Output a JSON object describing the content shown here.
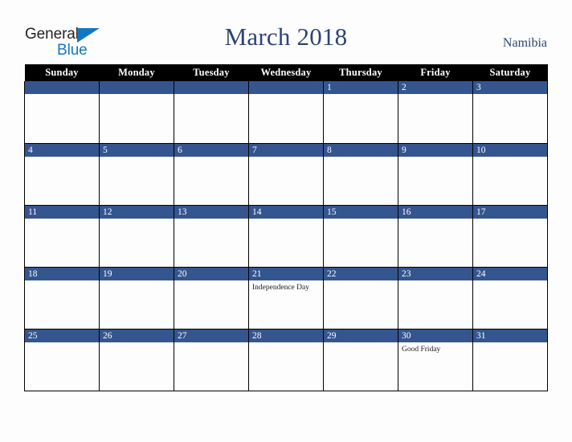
{
  "brand": {
    "logo_part1": "General",
    "logo_part2": "Blue",
    "triangle_icon": "blue-triangle-icon"
  },
  "header": {
    "title": "March 2018",
    "country": "Namibia"
  },
  "colors": {
    "header_bar": "#000000",
    "day_bar": "#35558f",
    "title_text": "#2d4470",
    "logo_blue": "#1278be",
    "background": "#fdfdfd"
  },
  "calendar": {
    "weekdays": [
      "Sunday",
      "Monday",
      "Tuesday",
      "Wednesday",
      "Thursday",
      "Friday",
      "Saturday"
    ],
    "weeks": [
      [
        {
          "day": "",
          "event": ""
        },
        {
          "day": "",
          "event": ""
        },
        {
          "day": "",
          "event": ""
        },
        {
          "day": "",
          "event": ""
        },
        {
          "day": "1",
          "event": ""
        },
        {
          "day": "2",
          "event": ""
        },
        {
          "day": "3",
          "event": ""
        }
      ],
      [
        {
          "day": "4",
          "event": ""
        },
        {
          "day": "5",
          "event": ""
        },
        {
          "day": "6",
          "event": ""
        },
        {
          "day": "7",
          "event": ""
        },
        {
          "day": "8",
          "event": ""
        },
        {
          "day": "9",
          "event": ""
        },
        {
          "day": "10",
          "event": ""
        }
      ],
      [
        {
          "day": "11",
          "event": ""
        },
        {
          "day": "12",
          "event": ""
        },
        {
          "day": "13",
          "event": ""
        },
        {
          "day": "14",
          "event": ""
        },
        {
          "day": "15",
          "event": ""
        },
        {
          "day": "16",
          "event": ""
        },
        {
          "day": "17",
          "event": ""
        }
      ],
      [
        {
          "day": "18",
          "event": ""
        },
        {
          "day": "19",
          "event": ""
        },
        {
          "day": "20",
          "event": ""
        },
        {
          "day": "21",
          "event": "Independence Day"
        },
        {
          "day": "22",
          "event": ""
        },
        {
          "day": "23",
          "event": ""
        },
        {
          "day": "24",
          "event": ""
        }
      ],
      [
        {
          "day": "25",
          "event": ""
        },
        {
          "day": "26",
          "event": ""
        },
        {
          "day": "27",
          "event": ""
        },
        {
          "day": "28",
          "event": ""
        },
        {
          "day": "29",
          "event": ""
        },
        {
          "day": "30",
          "event": "Good Friday"
        },
        {
          "day": "31",
          "event": ""
        }
      ]
    ]
  }
}
